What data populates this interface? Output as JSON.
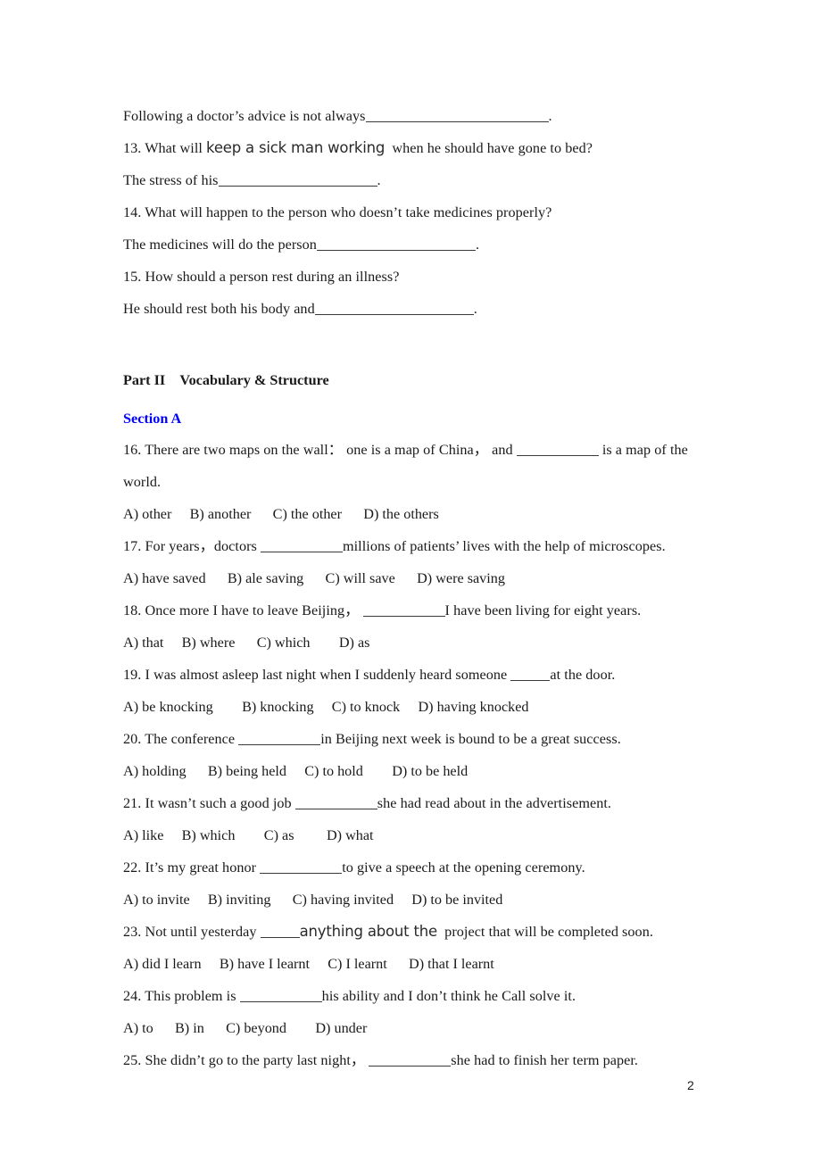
{
  "document": {
    "page_number": "2",
    "accent_color": "#0000ff",
    "text_color": "#1a1a1a"
  },
  "reading_answers": {
    "intro_line": {
      "before": "Following a doctor’s advice is not always",
      "after": "."
    },
    "questions": [
      {
        "number": "13.",
        "prompt_before": "What will ",
        "prompt_alt": "keep a sick man working",
        "prompt_after": "  when he should have gone to bed?",
        "answer_before": "The stress of his",
        "answer_after": "."
      },
      {
        "number": "14.",
        "prompt_before": "What will happen to the person who doesn’t take medicines properly?",
        "prompt_alt": "",
        "prompt_after": "",
        "answer_before": "The medicines will do the person",
        "answer_after": "."
      },
      {
        "number": "15.",
        "prompt_before": "How should a person rest during an illness?",
        "prompt_alt": "",
        "prompt_after": "",
        "answer_before": "He should rest both his body and",
        "answer_after": "."
      }
    ]
  },
  "part_two": {
    "heading": "Part II Vocabulary & Structure",
    "section_heading": "Section A",
    "questions": [
      {
        "number": "16.",
        "stem_before": "There are two maps on the wall： one is a map of China， and ",
        "stem_alt": "",
        "stem_after": " is a map of the world.",
        "blank_size": "w-md",
        "options": "A) other  B) another   C) the other   D) the others"
      },
      {
        "number": "17.",
        "stem_before": "For years，doctors ",
        "stem_alt": "",
        "stem_after": "millions of patients’ lives with the help of microscopes.",
        "blank_size": "w-md",
        "options": "A) have saved   B) ale saving   C) will save   D) were saving"
      },
      {
        "number": "18.",
        "stem_before": "Once more I have to leave Beijing， ",
        "stem_alt": "",
        "stem_after": "I have been living for eight years.",
        "blank_size": "w-md",
        "options": "A) that  B) where   C) which  D) as"
      },
      {
        "number": "19.",
        "stem_before": "I was almost asleep last night when I suddenly heard someone ",
        "stem_alt": "",
        "stem_after": "at the door.",
        "blank_size": "w-sm",
        "options": "A) be knocking  B) knocking  C) to knock  D) having knocked"
      },
      {
        "number": "20.",
        "stem_before": "The conference ",
        "stem_alt": "",
        "stem_after": "in Beijing next week is bound to be a great success.",
        "blank_size": "w-md",
        "options": "A) holding   B) being held  C) to hold  D) to be held"
      },
      {
        "number": "21.",
        "stem_before": "It wasn’t such a good job ",
        "stem_alt": "",
        "stem_after": "she had read about in the advertisement.",
        "blank_size": "w-md",
        "options": "A) like  B) which  C) as   D) what"
      },
      {
        "number": "22.",
        "stem_before": "It’s my great honor ",
        "stem_alt": "",
        "stem_after": "to give a speech at the opening ceremony.",
        "blank_size": "w-md",
        "options": "A) to invite  B) inviting   C) having invited  D) to be invited"
      },
      {
        "number": "23.",
        "stem_before": "Not until yesterday ",
        "stem_alt": "anything about the",
        "stem_after": "  project that will be completed soon.",
        "blank_size": "w-sm",
        "options": "A) did I learn  B) have I learnt  C) I learnt   D) that I learnt"
      },
      {
        "number": "24.",
        "stem_before": "This problem is ",
        "stem_alt": "",
        "stem_after": "his ability and I don’t think he Call solve it.",
        "blank_size": "w-md",
        "options": "A) to   B) in   C) beyond  D) under"
      },
      {
        "number": "25.",
        "stem_before": "She didn’t go to the party last night， ",
        "stem_alt": "",
        "stem_after": "she had to finish her term paper.",
        "blank_size": "w-md",
        "options": ""
      }
    ]
  }
}
